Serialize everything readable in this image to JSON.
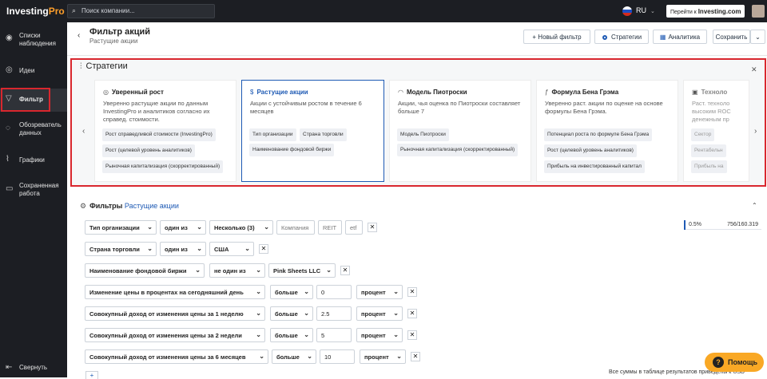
{
  "topbar": {
    "logo_main": "Investing",
    "logo_pro": "Pro",
    "search_placeholder": "Поиск компании...",
    "lang": "RU",
    "goto_label": "Перейти к",
    "goto_brand": "Investing.com"
  },
  "sidebar": {
    "items": [
      {
        "label": "Списки наблюдения",
        "icon": "watchlist-icon",
        "glyph": "◉"
      },
      {
        "label": "Идеи",
        "icon": "ideas-icon",
        "glyph": "◎"
      },
      {
        "label": "Фильтр",
        "icon": "filter-icon",
        "glyph": "▽"
      },
      {
        "label": "Обозреватель данных",
        "icon": "data-explorer-icon",
        "glyph": "◌"
      },
      {
        "label": "Графики",
        "icon": "charts-icon",
        "glyph": "⌇"
      },
      {
        "label": "Сохраненная работа",
        "icon": "saved-work-icon",
        "glyph": "▭"
      }
    ],
    "collapse_label": "Свернуть"
  },
  "header": {
    "title": "Фильтр акций",
    "subtitle": "Растущие акции",
    "new_filter": "+ Новый фильтр",
    "strategies": "Стратегии",
    "analytics": "Аналитика",
    "save": "Сохранить"
  },
  "strategies": {
    "title": "Стратегии",
    "cards": [
      {
        "title": "Уверенный рост",
        "desc": "Уверенно растущие акции по данным InvestingPro и аналитиков согласно их справед. стоимости.",
        "tags": [
          "Рост справедливой стоимости (InvestingPro)",
          "Рост (целевой уровень аналитиков)",
          "Рыночная капитализация (скорректированный)"
        ]
      },
      {
        "title": "Растущие акции",
        "desc": "Акции с устойчивым ростом в течение 6 месяцев",
        "tags": [
          "Тип организации",
          "Страна торговли",
          "Наименование фондовой биржи"
        ]
      },
      {
        "title": "Модель Пиотроски",
        "desc": "Акции, чья оценка по Пиотроски составляет больше 7",
        "tags": [
          "Модель Пиотроски",
          "Рыночная капитализация (скорректированный)"
        ]
      },
      {
        "title": "Формула Бена Грэма",
        "desc": "Уверенно раст. акции по оценке на основе формулы Бена Грэма.",
        "tags": [
          "Потенциал роста по формуле Бена Грэма",
          "Рост (целевой уровень аналитиков)",
          "Прибыль на инвестированный капитал"
        ]
      },
      {
        "title": "Техноло",
        "desc": "Раст. техноло высоким ROC денежным пр",
        "tags": [
          "Сектор",
          "Рентабельн",
          "Прибыль на"
        ]
      }
    ]
  },
  "filters": {
    "title": "Фильтры",
    "strategy_link": "Растущие акции",
    "result_percent": "0.5%",
    "result_count": "756/160.319",
    "rows": [
      {
        "field": "Тип организации",
        "op": "один из",
        "val": "Несколько (3)",
        "extra": [
          "Компания",
          "REIT",
          "etf"
        ]
      },
      {
        "field": "Страна торговли",
        "op": "один из",
        "val": "США"
      },
      {
        "field": "Наименование фондовой биржи",
        "op": "не один из",
        "val": "Pink Sheets LLC"
      },
      {
        "field": "Изменение цены в процентах на сегодняшний день",
        "op": "больше",
        "num": "0",
        "unit": "процент"
      },
      {
        "field": "Совокупный доход от изменения цены за 1 неделю",
        "op": "больше",
        "num": "2.5",
        "unit": "процент"
      },
      {
        "field": "Совокупный доход от изменения цены за 2 недели",
        "op": "больше",
        "num": "5",
        "unit": "процент"
      },
      {
        "field": "Совокупный доход от изменения цены за 6 месяцев",
        "op": "больше",
        "num": "10",
        "unit": "процент"
      }
    ]
  },
  "footer": {
    "help": "Помощь",
    "note": "Все суммы в таблице результатов приведены к USD"
  }
}
